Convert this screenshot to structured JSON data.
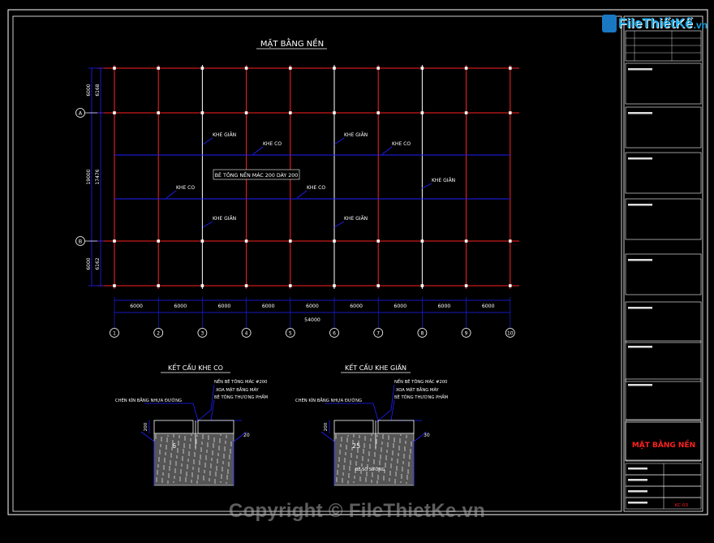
{
  "logo": {
    "brand": "FileThiếtKế",
    "tld": ".vn"
  },
  "watermark": "Copyright © FileThietKe.vn",
  "plan": {
    "title": "MẶT BẰNG NỀN",
    "axes_num": [
      "1",
      "2",
      "3",
      "4",
      "5",
      "6",
      "7",
      "8",
      "9",
      "10"
    ],
    "axes_letter": [
      "A",
      "B"
    ],
    "spans": [
      "6000",
      "6000",
      "6000",
      "6000",
      "6000",
      "6000",
      "6000",
      "6000",
      "6000"
    ],
    "total": "54000",
    "dims_left": [
      "6000",
      "19000",
      "6000"
    ],
    "dims_left2": [
      "6168",
      "17476",
      "6162"
    ],
    "note": "BÊ TÔNG NỀN MÁC 200 DÀY 200",
    "joint_shrink": "KHE GIÃN",
    "joint_contract": "KHE CO"
  },
  "detail_co": {
    "title": "KẾT CẤU KHE CO",
    "l1": "NỀN BÊ TÔNG MÁC #200",
    "l2": "XOA MẶT BẰNG MÁY",
    "l3": "BÊ TÔNG THƯƠNG PHẨM",
    "l4": "CHÈN KÍN BẰNG NHỰA ĐƯỜNG",
    "d1": "200",
    "d2": "20",
    "d3": "6"
  },
  "detail_gian": {
    "title": "KẾT CẤU KHE GIÃN",
    "l1": "NỀN BÊ TÔNG MÁC #200",
    "l2": "XOA MẶT BẰNG MÁY",
    "l3": "BÊ TÔNG THƯƠNG PHẨM",
    "l4": "CHÈN KÍN BẰNG NHỰA ĐƯỜNG",
    "l5": "BÊ SỐ SƯỜNG",
    "d1": "200",
    "d2": "30",
    "d3": "25"
  },
  "title_block": {
    "drawing_title": "MẶT BẰNG NỀN",
    "code": "KC-03",
    "colors": {
      "title": "#ff2020",
      "frame": "#ffffff",
      "grid_red": "#ff2020",
      "grid_blue": "#2020ff"
    }
  }
}
